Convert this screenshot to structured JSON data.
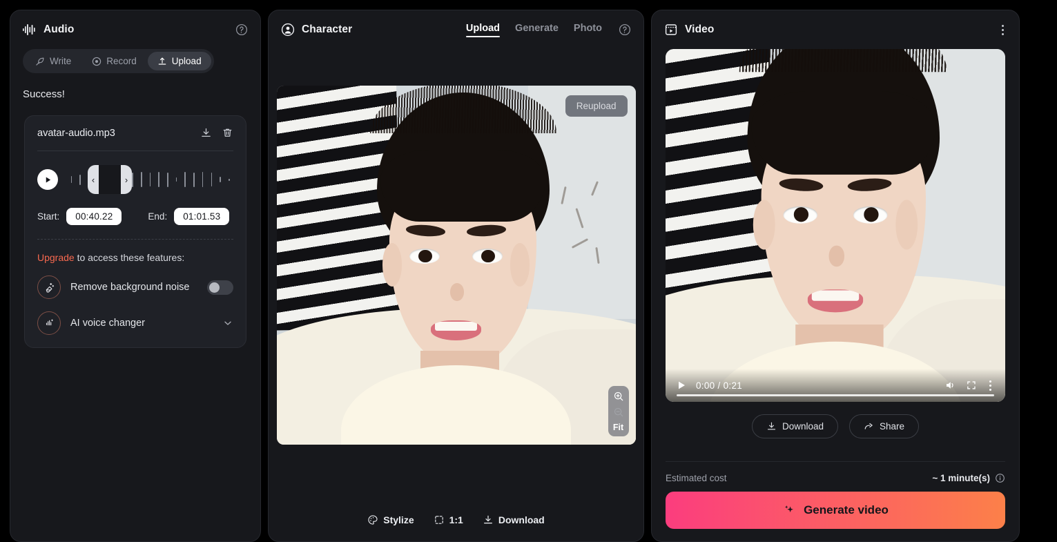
{
  "audio": {
    "title": "Audio",
    "help_icon": "help-circle-icon",
    "modes": [
      {
        "label": "Write",
        "icon": "feather-pen-icon",
        "active": false
      },
      {
        "label": "Record",
        "icon": "record-dot-icon",
        "active": false
      },
      {
        "label": "Upload",
        "icon": "upload-arrow-icon",
        "active": true
      }
    ],
    "status": "Success!",
    "file": {
      "name": "avatar-audio.mp3",
      "download_icon": "download-icon",
      "delete_icon": "trash-icon"
    },
    "player": {
      "play_icon": "play-icon",
      "handle_left": "‹",
      "handle_right": "›"
    },
    "trim": {
      "start_label": "Start:",
      "start_value": "00:40.22",
      "end_label": "End:",
      "end_value": "01:01.53"
    },
    "upgrade": {
      "link": "Upgrade",
      "text": " to access these features:",
      "link_color": "#f8694f"
    },
    "features": [
      {
        "label": "Remove background noise",
        "icon": "magic-eraser-icon",
        "control": "toggle",
        "enabled": false
      },
      {
        "label": "AI voice changer",
        "icon": "voice-wave-icon",
        "control": "chevron",
        "enabled": false
      }
    ]
  },
  "character": {
    "title": "Character",
    "avatar_icon": "user-circle-icon",
    "help_icon": "help-circle-icon",
    "tabs": [
      {
        "label": "Upload",
        "active": true
      },
      {
        "label": "Generate",
        "active": false
      },
      {
        "label": "Photo",
        "active": false
      }
    ],
    "reupload_label": "Reupload",
    "zoom": {
      "zoom_in_icon": "zoom-in-icon",
      "zoom_out_icon": "zoom-out-icon",
      "fit_label": "Fit"
    },
    "footer": [
      {
        "label": "Stylize",
        "icon": "palette-icon"
      },
      {
        "label": "1:1",
        "icon": "aspect-ratio-icon"
      },
      {
        "label": "Download",
        "icon": "download-icon"
      }
    ]
  },
  "video": {
    "title": "Video",
    "video_icon": "film-play-icon",
    "menu_icon": "kebab-menu-icon",
    "player": {
      "play_icon": "play-icon",
      "time": "0:00 / 0:21",
      "current_time": "0:00",
      "duration": "0:21",
      "volume_icon": "volume-icon",
      "fullscreen_icon": "fullscreen-icon",
      "more_icon": "kebab-menu-icon",
      "progress_percent": 0
    },
    "actions": [
      {
        "label": "Download",
        "icon": "download-icon"
      },
      {
        "label": "Share",
        "icon": "share-arrow-icon"
      }
    ],
    "cost": {
      "label": "Estimated cost",
      "value": "~ 1 minute(s)",
      "info_icon": "info-circle-icon"
    },
    "generate": {
      "label": "Generate video",
      "icon": "sparkle-icon",
      "gradient_from": "#fb3d7e",
      "gradient_to": "#fc8049"
    }
  },
  "theme": {
    "page_bg": "#000000",
    "panel_bg": "#17181c",
    "panel_border": "#26282e",
    "text_primary": "#eceef2",
    "text_muted": "#9ea1aa",
    "accent": "#f8694f"
  }
}
